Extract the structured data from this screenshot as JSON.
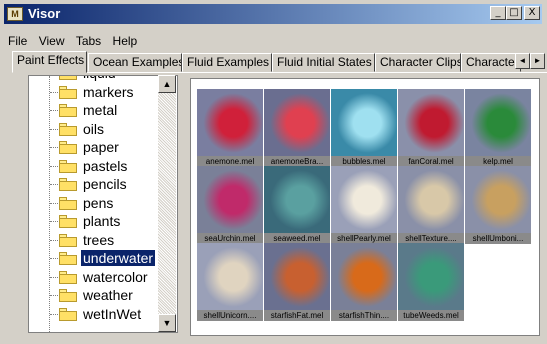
{
  "window": {
    "title": "Visor",
    "icon_text": "M"
  },
  "title_buttons": {
    "minimize": "_",
    "maximize": "□",
    "close": "X"
  },
  "menu": [
    "File",
    "View",
    "Tabs",
    "Help"
  ],
  "tabs": [
    "Paint Effects",
    "Ocean Examples",
    "Fluid Examples",
    "Fluid Initial States",
    "Character Clips",
    "Character Po"
  ],
  "active_tab": "Paint Effects",
  "tab_scroll": {
    "left": "◄",
    "right": "►"
  },
  "tree": {
    "items": [
      "liquid",
      "markers",
      "metal",
      "oils",
      "paper",
      "pastels",
      "pencils",
      "pens",
      "plants",
      "trees",
      "underwater",
      "watercolor",
      "weather",
      "wetInWet"
    ],
    "selected": "underwater"
  },
  "scrollbar": {
    "up": "▲",
    "down": "▼"
  },
  "gallery": {
    "items": [
      {
        "label": "anemone.mel",
        "bg": "#7a7ea0",
        "fg": "#d0203a"
      },
      {
        "label": "anemoneBra...",
        "bg": "#6a6e90",
        "fg": "#e04050"
      },
      {
        "label": "bubbles.mel",
        "bg": "#3a8aa8",
        "fg": "#9fe0f0"
      },
      {
        "label": "fanCoral.mel",
        "bg": "#8a90aa",
        "fg": "#c01a30"
      },
      {
        "label": "kelp.mel",
        "bg": "#7a84a0",
        "fg": "#2a8a3a"
      },
      {
        "label": "seaUrchin.mel",
        "bg": "#7a8098",
        "fg": "#c02a6a"
      },
      {
        "label": "seaweed.mel",
        "bg": "#3a6a7a",
        "fg": "#5aa0a0"
      },
      {
        "label": "shellPearly.mel",
        "bg": "#9aa0b8",
        "fg": "#f0eadc"
      },
      {
        "label": "shellTexture....",
        "bg": "#8a90a8",
        "fg": "#d8c8a8"
      },
      {
        "label": "shellUmboni...",
        "bg": "#8a90a8",
        "fg": "#c8a060"
      },
      {
        "label": "shellUnicorn....",
        "bg": "#9aa0b8",
        "fg": "#e0d4c0"
      },
      {
        "label": "starfishFat.mel",
        "bg": "#6a7090",
        "fg": "#c86030"
      },
      {
        "label": "starfishThin....",
        "bg": "#7a8098",
        "fg": "#d86a1a"
      },
      {
        "label": "tubeWeeds.mel",
        "bg": "#5a7a8a",
        "fg": "#3a9a7a"
      }
    ]
  }
}
